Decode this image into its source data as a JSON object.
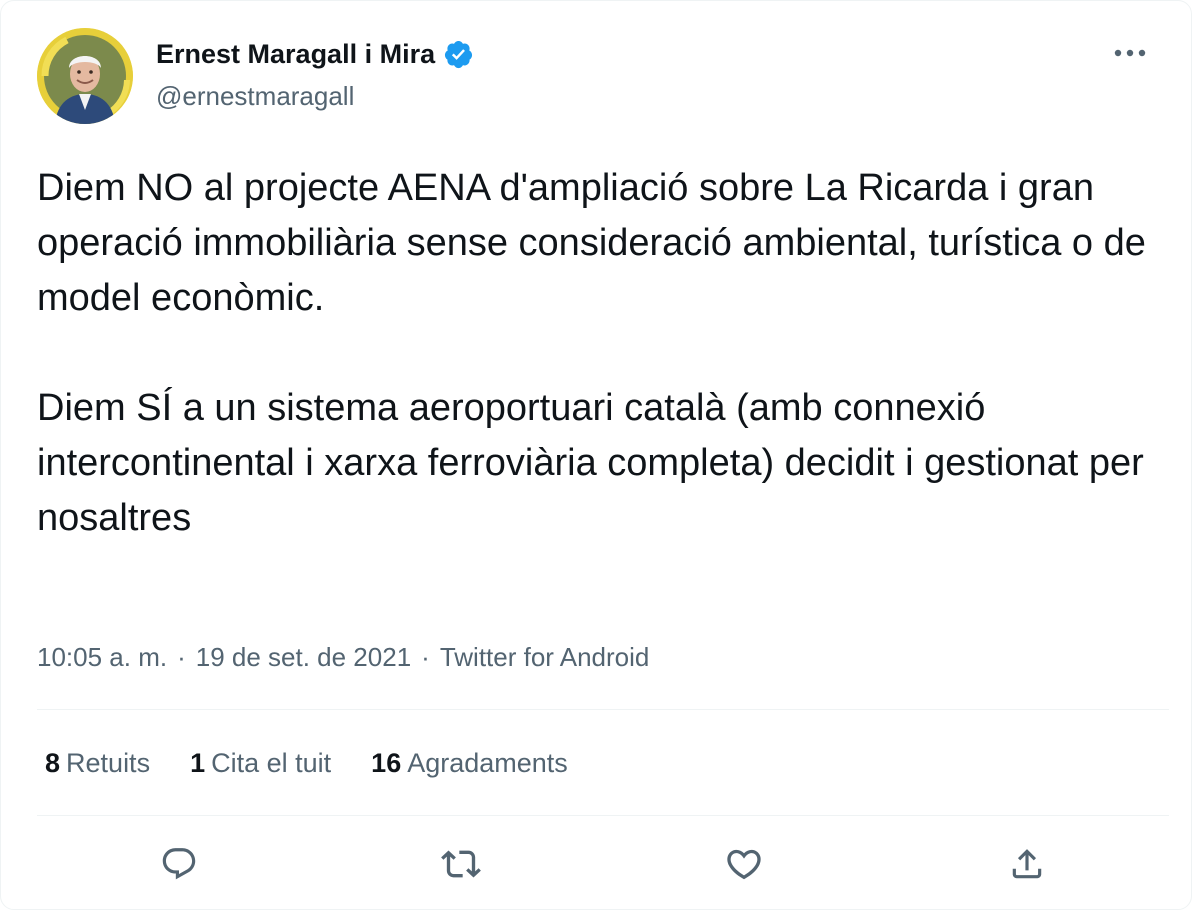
{
  "author": {
    "display_name": "Ernest Maragall i Mira",
    "handle": "@ernestmaragall",
    "verified": true,
    "avatar_icon": "profile-photo"
  },
  "tweet": {
    "text": "Diem NO al projecte AENA d'ampliació sobre La Ricarda i gran operació immobiliària sense consideració ambiental, turística o de model econòmic.\n\nDiem SÍ a un sistema aeroportuari català (amb connexió intercontinental i xarxa ferroviària completa) decidit i gestionat per nosaltres",
    "time": "10:05 a. m.",
    "date": "19 de set. de 2021",
    "source": "Twitter for Android",
    "separator": "·"
  },
  "stats": {
    "retweets_count": "8",
    "retweets_label": "Retuits",
    "quotes_count": "1",
    "quotes_label": "Cita el tuit",
    "likes_count": "16",
    "likes_label": "Agradaments"
  },
  "actions": [
    "reply-icon",
    "retweet-icon",
    "like-icon",
    "share-icon"
  ],
  "colors": {
    "text": "#0f1419",
    "secondary": "#536471",
    "verified": "#1d9bf0",
    "divider": "#eff3f4",
    "avatar_ring": "#e9d54a"
  }
}
